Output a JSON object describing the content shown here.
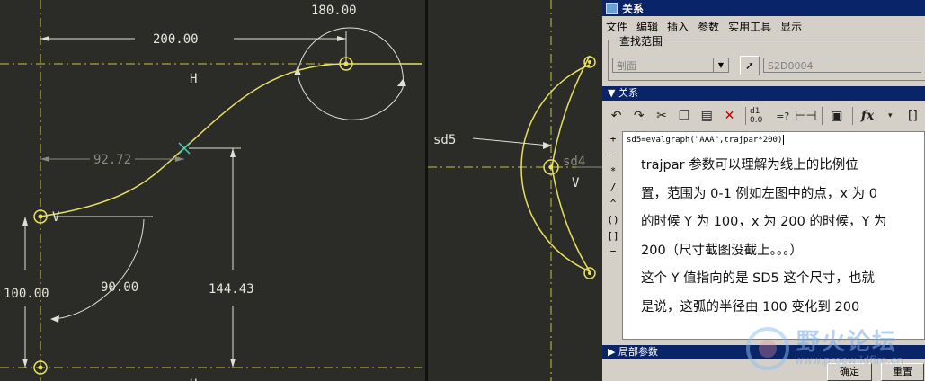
{
  "cad_left": {
    "dims": {
      "d1": "200.00",
      "d2": "180.00",
      "d3": "92.72",
      "d4": "100.00",
      "d5": "90.00",
      "d6": "144.43"
    },
    "labels": {
      "h_top": "H",
      "v_left": "V",
      "h_bottom": "H"
    }
  },
  "cad_right": {
    "sd5_label": "sd5",
    "dim_sd4": "sd4",
    "v_label": "V"
  },
  "dialog": {
    "title": "关系",
    "menu": [
      "文件",
      "编辑",
      "插入",
      "参数",
      "实用工具",
      "显示"
    ],
    "lookup": {
      "label": "查找范围",
      "scope_value": "剖面",
      "feature_value": "S2D0004"
    },
    "relations_header": "关系",
    "relation_code": "sd5=evalgraph(\"AAA\",trajpar*200)",
    "operators": [
      "+",
      "−",
      "*",
      "/",
      "^",
      "()",
      "[]",
      "="
    ],
    "note_lines": [
      "trajpar 参数可以理解为线上的比例位",
      "置，范围为 0-1 例如左图中的点，x 为 0",
      "的时候 Y 为 100，x 为 200 的时候，Y 为",
      "200（尺寸截图没截上。。。）",
      "这个 Y 值指向的是 SD5 这个尺寸，也就",
      "是说，这弧的半径由 100 变化到 200"
    ],
    "local_params": "局部参数",
    "ok_label": "确定",
    "reset_label": "重置",
    "fx_label": "fx"
  },
  "watermark": {
    "text": "野火论坛",
    "sub": "www.proewildfire.cn"
  },
  "colors": {
    "cad_bg": "#2b2b27",
    "curve": "#e8e060",
    "dialog_bg": "#d4d0c8",
    "titlebar": "#0a246a"
  }
}
